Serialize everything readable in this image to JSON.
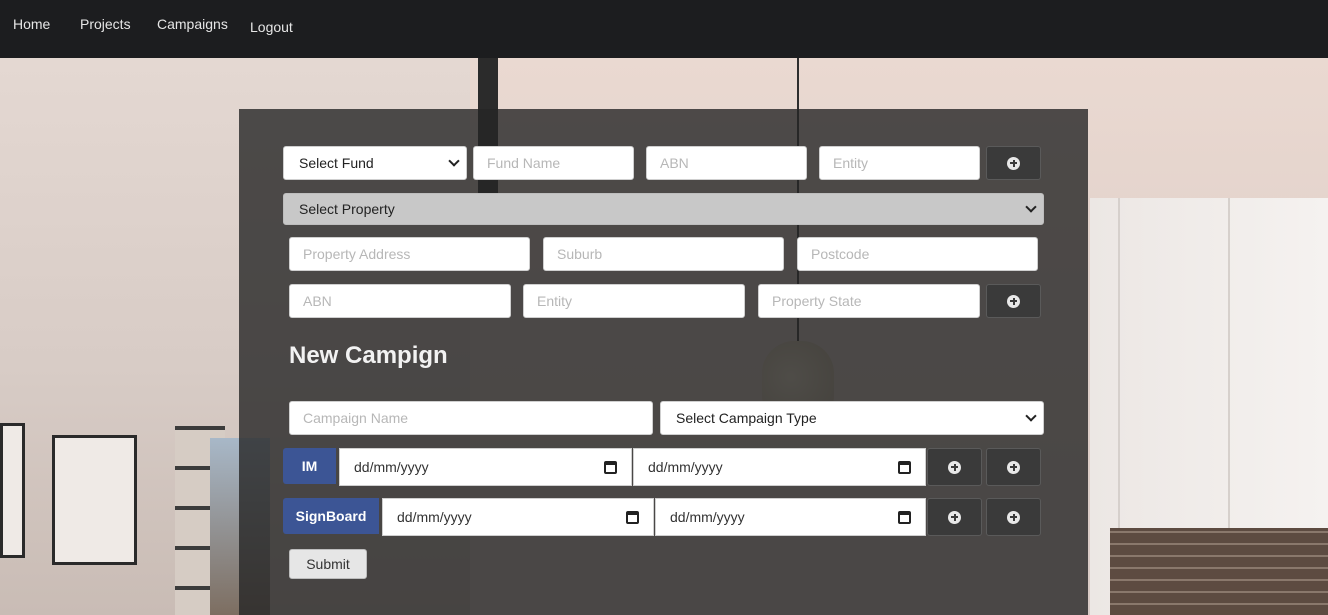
{
  "nav": {
    "home": "Home",
    "projects": "Projects",
    "campaigns": "Campaigns",
    "logout": "Logout"
  },
  "fund": {
    "select_value": "Select Fund",
    "name_placeholder": "Fund Name",
    "abn_placeholder": "ABN",
    "entity_placeholder": "Entity"
  },
  "property": {
    "select_value": "Select Property",
    "address_placeholder": "Property Address",
    "suburb_placeholder": "Suburb",
    "postcode_placeholder": "Postcode",
    "abn_placeholder": "ABN",
    "entity_placeholder": "Entity",
    "state_placeholder": "Property State"
  },
  "campaign": {
    "title": "New Campign",
    "name_placeholder": "Campaign Name",
    "type_value": "Select Campaign Type",
    "rows": [
      {
        "label": "IM",
        "start": "dd/mm/yyyy",
        "end": "dd/mm/yyyy"
      },
      {
        "label": "SignBoard",
        "start": "dd/mm/yyyy",
        "end": "dd/mm/yyyy"
      }
    ],
    "submit": "Submit"
  },
  "colors": {
    "navbar": "#1c1d1f",
    "panel": "#262626",
    "label_button": "#3c5595"
  }
}
